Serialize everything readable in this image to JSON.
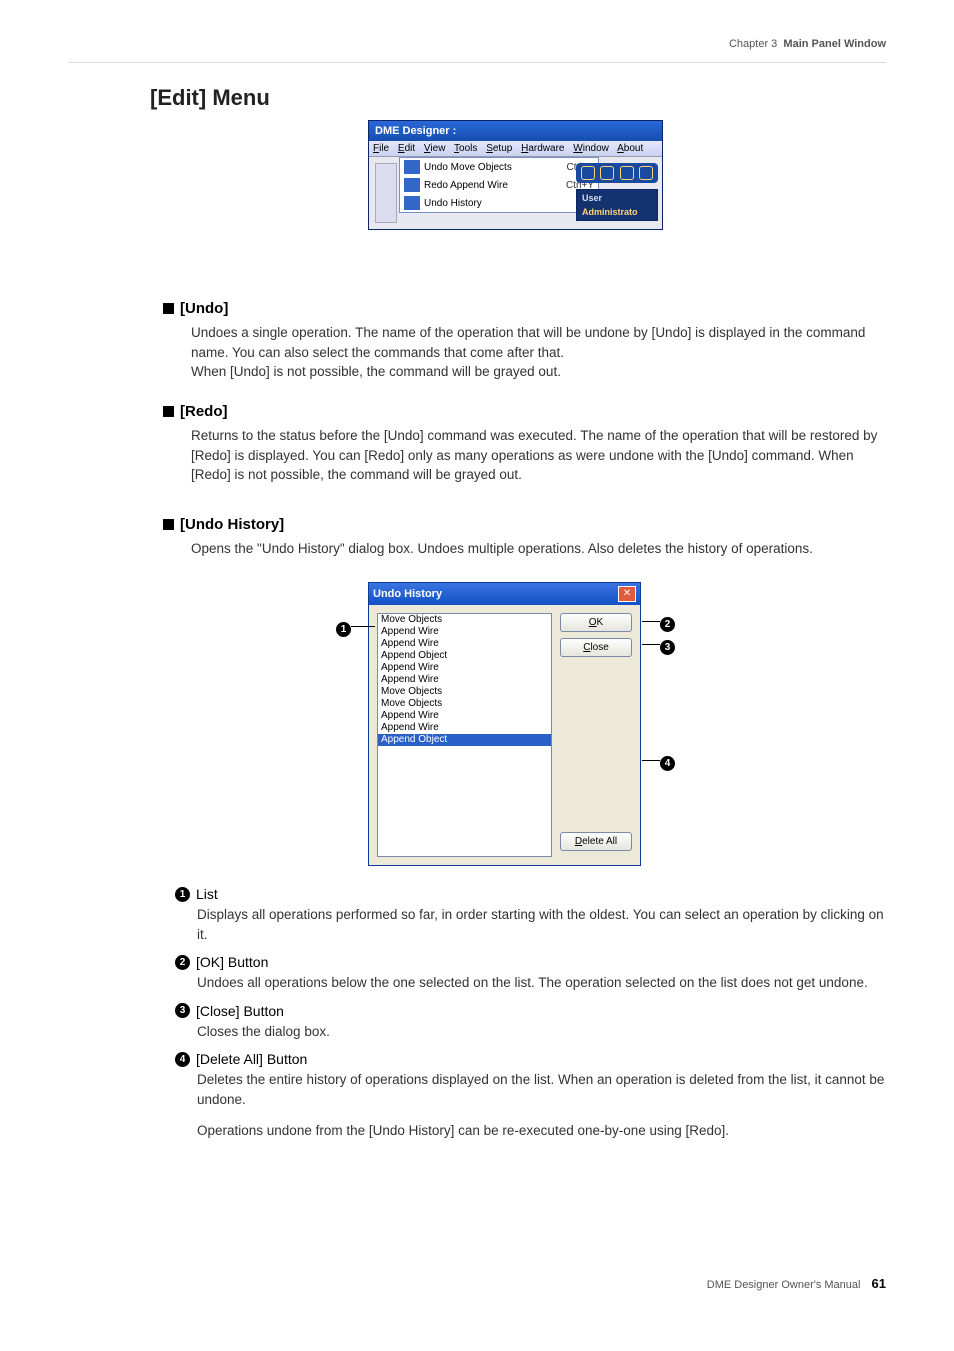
{
  "header": {
    "chapter": "Chapter 3",
    "section": "Main Panel Window"
  },
  "page_title": "[Edit] Menu",
  "win1": {
    "title": "DME Designer :",
    "menu": [
      "File",
      "Edit",
      "View",
      "Tools",
      "Setup",
      "Hardware",
      "Window",
      "About"
    ],
    "edit_items": [
      {
        "label": "Undo Move Objects",
        "shortcut": "Ctrl+Z"
      },
      {
        "label": "Redo Append Wire",
        "shortcut": "Ctrl+Y"
      },
      {
        "label": "Undo History",
        "shortcut": ""
      }
    ],
    "user_label": "User",
    "user_value": "Administrato"
  },
  "sections": {
    "undo": {
      "title": "[Undo]",
      "body": "Undoes a single operation. The name of the operation that will be undone by [Undo] is displayed in the command name. You can also select the commands that come after that.\nWhen [Undo] is not possible, the command will be grayed out."
    },
    "redo": {
      "title": "[Redo]",
      "body": "Returns to the status before the [Undo] command was executed. The name of the operation that will be restored by [Redo] is displayed. You can [Redo] only as many operations as were undone with the [Undo] command. When [Redo] is not possible, the command will be grayed out."
    },
    "hist": {
      "title": "[Undo History]",
      "body": "Opens the \"Undo History\" dialog box. Undoes multiple operations. Also deletes the history of operations."
    }
  },
  "win2": {
    "title": "Undo History",
    "list": [
      "Move Objects",
      "Append Wire",
      "Append Wire",
      "Append Object",
      "Append Wire",
      "Append Wire",
      "Move Objects",
      "Move Objects",
      "Append Wire",
      "Append Wire",
      "Append Object"
    ],
    "selected_index": 10,
    "buttons": {
      "ok": "OK",
      "close": "Close",
      "delete_all": "Delete All"
    }
  },
  "items": [
    {
      "num": "1",
      "title": "List",
      "body": "Displays all operations performed so far, in order starting with the oldest. You can select an operation by clicking on it."
    },
    {
      "num": "2",
      "title": "[OK] Button",
      "body": "Undoes all operations below the one selected on the list. The operation selected on the list does not get undone."
    },
    {
      "num": "3",
      "title": "[Close] Button",
      "body": "Closes the dialog box."
    },
    {
      "num": "4",
      "title": "[Delete All] Button",
      "body": "Deletes the entire history of operations displayed on the list. When an operation is deleted from the list, it cannot be undone."
    }
  ],
  "post_items_para": "Operations undone from the [Undo History] can be re-executed one-by-one using [Redo].",
  "footer": {
    "text": "DME Designer Owner's Manual",
    "page": "61"
  }
}
